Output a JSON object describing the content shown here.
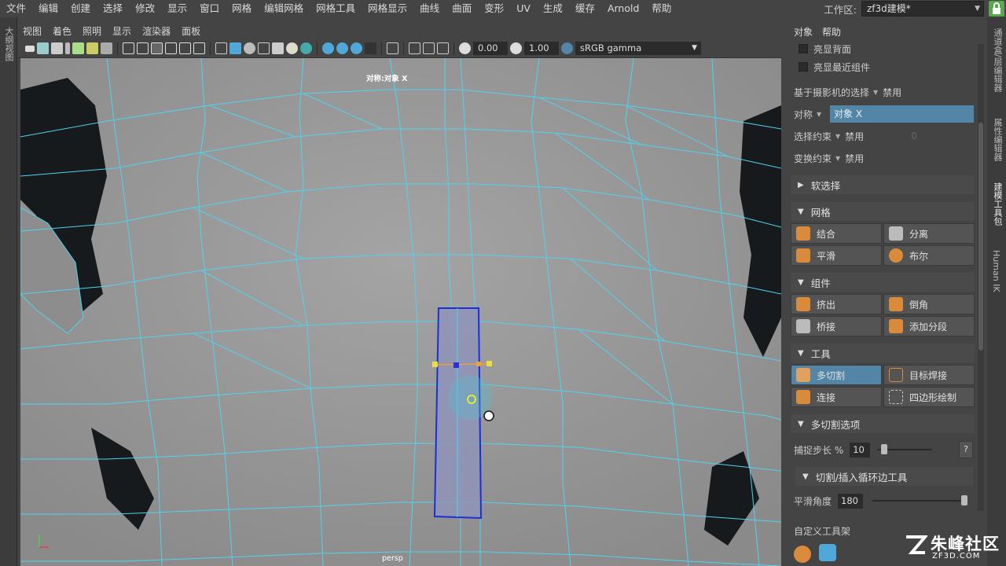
{
  "menubar": {
    "items": [
      "文件",
      "编辑",
      "创建",
      "选择",
      "修改",
      "显示",
      "窗口",
      "网格",
      "编辑网格",
      "网格工具",
      "网格显示",
      "曲线",
      "曲面",
      "变形",
      "UV",
      "生成",
      "缓存",
      "Arnold",
      "帮助"
    ],
    "workspace_label": "工作区:",
    "workspace_value": "zf3d建模*"
  },
  "left_strip": {
    "tab_label": "大纲视图"
  },
  "viewport": {
    "menus": [
      "视图",
      "着色",
      "照明",
      "显示",
      "渲染器",
      "面板"
    ],
    "exposure_value": "0.00",
    "gamma_value": "1.00",
    "colorspace": "sRGB gamma",
    "symmetry_label": "对称:对象 X",
    "camera_label": "persp"
  },
  "right_panel": {
    "menus": [
      "对象",
      "帮助"
    ],
    "backface_label": "亮显背面",
    "nearest_label": "亮显最近组件",
    "camera_select_label": "基于摄影机的选择",
    "camera_select_value": "禁用",
    "symmetry_label": "对称",
    "symmetry_value": "对象 X",
    "select_constraint_label": "选择约束",
    "select_constraint_value": "禁用",
    "select_constraint_num": "0",
    "transform_constraint_label": "变换约束",
    "transform_constraint_value": "禁用",
    "soft_select_label": "软选择",
    "mesh_section": "网格",
    "mesh_tools": [
      "结合",
      "分离",
      "平滑",
      "布尔"
    ],
    "component_section": "组件",
    "component_tools": [
      "挤出",
      "倒角",
      "桥接",
      "添加分段"
    ],
    "tools_section": "工具",
    "tools": [
      "多切割",
      "目标焊接",
      "连接",
      "四边形绘制"
    ],
    "multicut_options": "多切割选项",
    "snap_label": "捕捉步长 %",
    "snap_value": "10",
    "help_button": "?",
    "loop_tool_label": "切割/插入循环边工具",
    "smooth_angle_label": "平滑角度",
    "smooth_angle_value": "180",
    "custom_shelf_label": "自定义工具架"
  },
  "right_tabs": [
    "通道盒/层编辑器",
    "属性编辑器",
    "建模工具包",
    "Human IK"
  ],
  "watermark": {
    "title": "朱峰社区",
    "url": "ZF3D.COM"
  },
  "colors": {
    "accent": "#5285a6",
    "wire": "#4fd3f0",
    "mesh": "#9a9a9a"
  }
}
